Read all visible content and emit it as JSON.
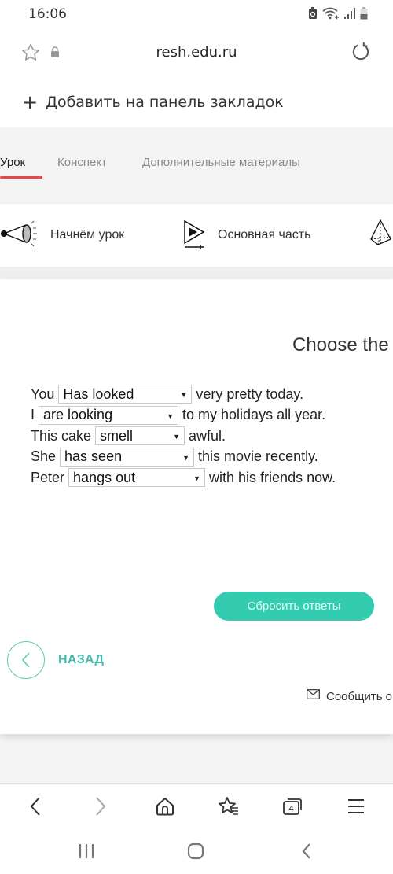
{
  "status_bar": {
    "time": "16:06",
    "icons": [
      "battery-saver-icon",
      "wifi-icon",
      "signal-icon",
      "battery-icon"
    ]
  },
  "browser": {
    "url": "resh.edu.ru",
    "add_bookmark_label": "Добавить на панель закладок",
    "toolbar_icons": [
      "back-icon",
      "forward-icon",
      "home-icon",
      "bookmarks-icon",
      "tabs-icon",
      "menu-icon"
    ],
    "tab_count": "4"
  },
  "page": {
    "tabs": [
      {
        "label": "Урок",
        "active": true
      },
      {
        "label": "Конспект",
        "active": false
      },
      {
        "label": "Дополнительные материалы",
        "active": false
      }
    ],
    "steps": [
      {
        "label": "Начнём урок",
        "icon": "megaphone-icon"
      },
      {
        "label": "Основная часть",
        "icon": "play-icon"
      },
      {
        "label": "",
        "icon": "pyramid-icon"
      }
    ],
    "task_title": "Choose the",
    "sentences": [
      {
        "before": "You",
        "selected": "Has looked",
        "after": "very pretty today."
      },
      {
        "before": "I",
        "selected": "are looking",
        "after": "to my holidays all year."
      },
      {
        "before": "This cake",
        "selected": "smell",
        "after": "awful."
      },
      {
        "before": "She",
        "selected": "has seen",
        "after": "this movie recently."
      },
      {
        "before": "Peter",
        "selected": "hangs out",
        "after": "with his friends now."
      }
    ],
    "reset_button": "Сбросить ответы",
    "back_label": "НАЗАД",
    "report_label": "Сообщить о",
    "colors": {
      "accent": "#33ccb1",
      "tab_underline": "#e8474a",
      "back_text": "#45b9a8"
    }
  }
}
